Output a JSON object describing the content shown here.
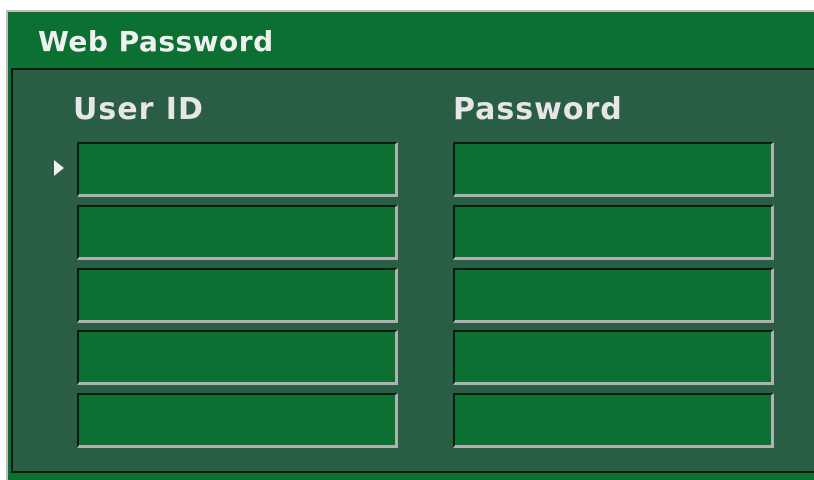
{
  "window": {
    "title": "Web Password"
  },
  "columns": {
    "user_id": "User ID",
    "password": "Password"
  },
  "rows": [
    {
      "user_id": "",
      "password": ""
    },
    {
      "user_id": "",
      "password": ""
    },
    {
      "user_id": "",
      "password": ""
    },
    {
      "user_id": "",
      "password": ""
    },
    {
      "user_id": "",
      "password": ""
    }
  ],
  "selected_row": 1,
  "icons": {
    "row_pointer": "triangle-right-icon"
  },
  "colors": {
    "title_bar": "#0c7033",
    "panel": "#2a5e44",
    "field": "#0c7033",
    "text": "#f0f0f0"
  }
}
